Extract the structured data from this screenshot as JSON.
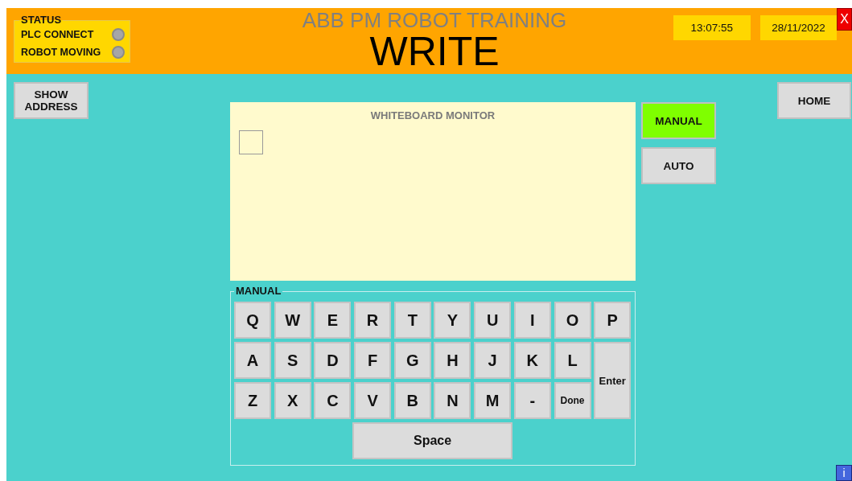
{
  "header": {
    "status": {
      "title": "STATUS",
      "indicators": [
        {
          "label": "PLC CONNECT",
          "on": false
        },
        {
          "label": "ROBOT MOVING",
          "on": false
        }
      ]
    },
    "subtitle": "ABB PM ROBOT TRAINING",
    "title": "WRITE",
    "time": "13:07:55",
    "date": "28/11/2022",
    "close": "X"
  },
  "show_address": "SHOW ADDRESS",
  "monitor": {
    "title": "WHITEBOARD MONITOR"
  },
  "modes": [
    {
      "label": "MANUAL",
      "selected": true
    },
    {
      "label": "AUTO",
      "selected": false
    }
  ],
  "home": "HOME",
  "keyboard": {
    "title": "MANUAL",
    "keys": [
      {
        "label": "Q",
        "kind": "letter"
      },
      {
        "label": "W",
        "kind": "letter"
      },
      {
        "label": "E",
        "kind": "letter"
      },
      {
        "label": "R",
        "kind": "letter"
      },
      {
        "label": "T",
        "kind": "letter"
      },
      {
        "label": "Y",
        "kind": "letter"
      },
      {
        "label": "U",
        "kind": "letter"
      },
      {
        "label": "I",
        "kind": "letter"
      },
      {
        "label": "O",
        "kind": "letter"
      },
      {
        "label": "P",
        "kind": "letter"
      },
      {
        "label": "A",
        "kind": "letter"
      },
      {
        "label": "S",
        "kind": "letter"
      },
      {
        "label": "D",
        "kind": "letter"
      },
      {
        "label": "F",
        "kind": "letter"
      },
      {
        "label": "G",
        "kind": "letter"
      },
      {
        "label": "H",
        "kind": "letter"
      },
      {
        "label": "J",
        "kind": "letter"
      },
      {
        "label": "K",
        "kind": "letter"
      },
      {
        "label": "L",
        "kind": "letter"
      },
      {
        "label": "Enter",
        "kind": "enter"
      },
      {
        "label": "Z",
        "kind": "letter"
      },
      {
        "label": "X",
        "kind": "letter"
      },
      {
        "label": "C",
        "kind": "letter"
      },
      {
        "label": "V",
        "kind": "letter"
      },
      {
        "label": "B",
        "kind": "letter"
      },
      {
        "label": "N",
        "kind": "letter"
      },
      {
        "label": "M",
        "kind": "letter"
      },
      {
        "label": "-",
        "kind": "letter"
      },
      {
        "label": "Done",
        "kind": "done"
      },
      {
        "label": "Space",
        "kind": "space"
      }
    ]
  },
  "info": "i"
}
